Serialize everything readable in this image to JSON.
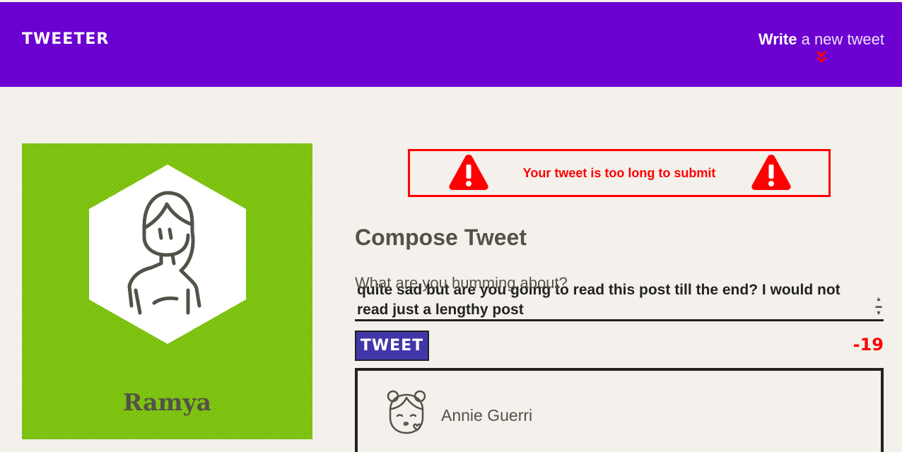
{
  "nav": {
    "brand": "TWEETER",
    "write_strong": "Write",
    "write_rest": " a new tweet",
    "chevron_icon": "double-chevron-down-icon",
    "bg_color": "#6b00d1",
    "chevron_color": "#ff0000"
  },
  "profile": {
    "name": "Ramya",
    "avatar_icon": "woman-avatar-icon",
    "bg_color": "#7ec60d"
  },
  "error": {
    "message": "Your tweet is too long to submit",
    "icon": "warning-triangle-icon",
    "color": "#ff0000"
  },
  "compose": {
    "title": "Compose Tweet",
    "label": "What are you humming about?",
    "text_line1": "quite sad but are you going to read this post till the end? I would not",
    "text_line2": "read just a lengthy post",
    "button_label": "TWEET",
    "counter": "-19",
    "button_color": "#4137a8"
  },
  "tweets": [
    {
      "name": "Annie Guerri",
      "avatar_icon": "girl-kiss-avatar-icon"
    }
  ]
}
